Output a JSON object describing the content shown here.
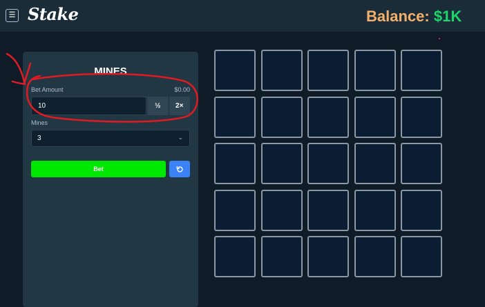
{
  "header": {
    "menu_icon": "☰",
    "logo_text": "Stake",
    "balance_label": "Balance:",
    "balance_value": "$1K"
  },
  "sidebar": {
    "title": "MINES",
    "bet_amount_label": "Bet Amount",
    "bet_amount_usd": "$0.00",
    "bet_amount_value": "10",
    "half_label": "½",
    "double_label": "2×",
    "mines_label": "Mines",
    "mines_value": "3",
    "bet_button_label": "Bet",
    "reset_icon": "refresh-icon"
  },
  "board": {
    "rows": 5,
    "cols": 5,
    "tile_count": 25
  },
  "colors": {
    "background": "#0f1c28",
    "topbar": "#1a2c38",
    "panel": "#213743",
    "bet_button": "#00e701",
    "reset_button": "#3b82f6",
    "balance_label": "#f4b06a",
    "balance_value": "#19d76a",
    "tile": "#0b1d33",
    "tile_border": "#8c98a4",
    "annotation": "#e01b24"
  }
}
